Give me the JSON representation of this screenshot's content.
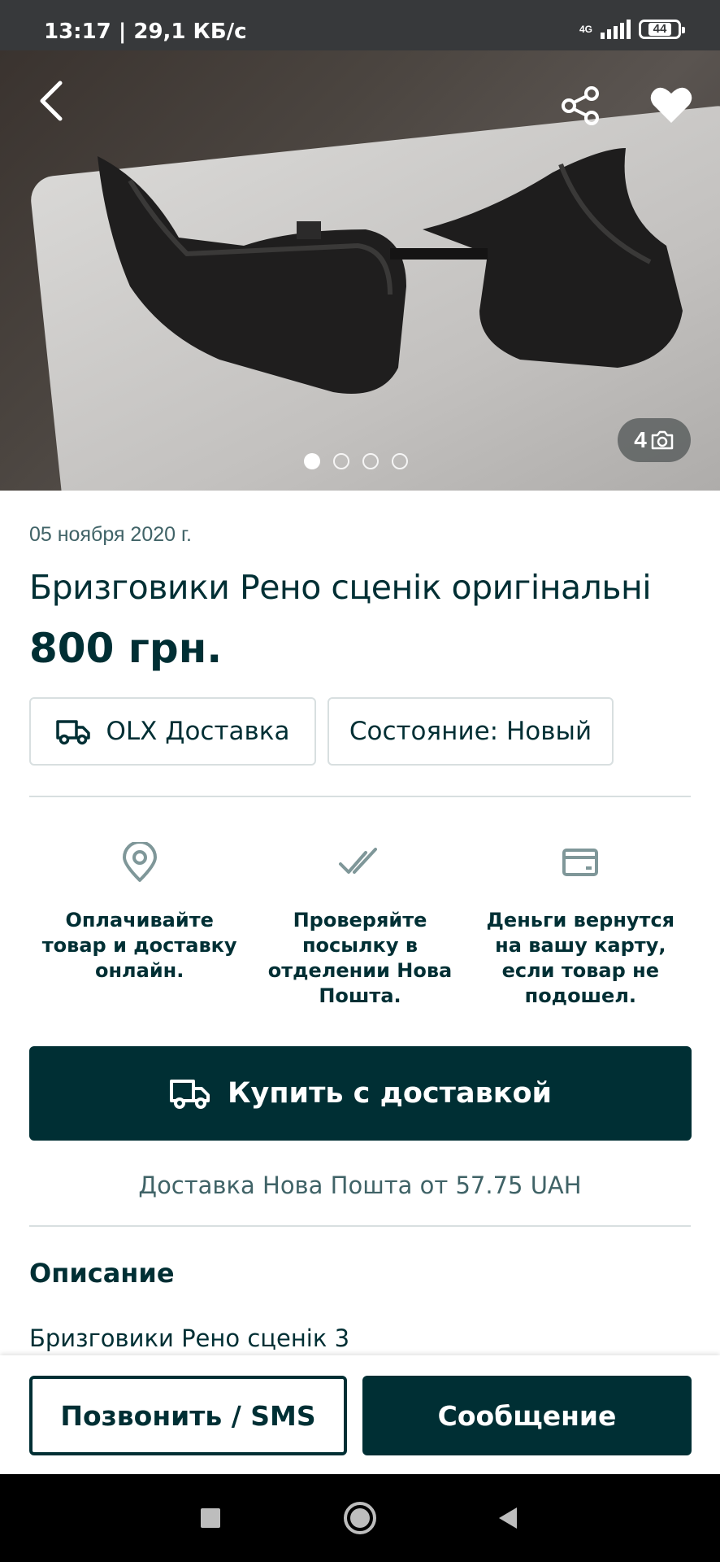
{
  "status_bar": {
    "time": "13:17 | 29,1 КБ/с",
    "network": "4G",
    "battery": "44"
  },
  "gallery": {
    "photo_count": "4",
    "icons": {
      "back": "back-arrow-icon",
      "share": "share-icon",
      "favorite": "heart-icon",
      "camera": "camera-icon"
    },
    "dots_total": 4,
    "active_dot": 1
  },
  "listing": {
    "date": "05 ноября 2020 г.",
    "title": "Бризговики Рено сценік оригінальні",
    "price": "800 грн.",
    "chips": {
      "delivery": "OLX Доставка",
      "condition": "Состояние: Новый"
    }
  },
  "features": [
    {
      "icon": "location-pin-icon",
      "text": "Оплачивайте товар и доставку онлайн."
    },
    {
      "icon": "double-check-icon",
      "text": "Проверяйте посылку в отделении Нова Пошта."
    },
    {
      "icon": "credit-card-icon",
      "text": "Деньги вернутся на вашу карту, если товар не подошел."
    }
  ],
  "buy": {
    "label": "Купить с доставкой",
    "note": "Доставка Нова Пошта от 57.75 UAH"
  },
  "description": {
    "heading": "Описание",
    "text": "Бризговики Рено сценік 3"
  },
  "actions": {
    "call": "Позвонить / SMS",
    "message": "Сообщение"
  },
  "colors": {
    "primary": "#002f34",
    "muted_text": "#406367",
    "border": "#d8dfe0"
  }
}
